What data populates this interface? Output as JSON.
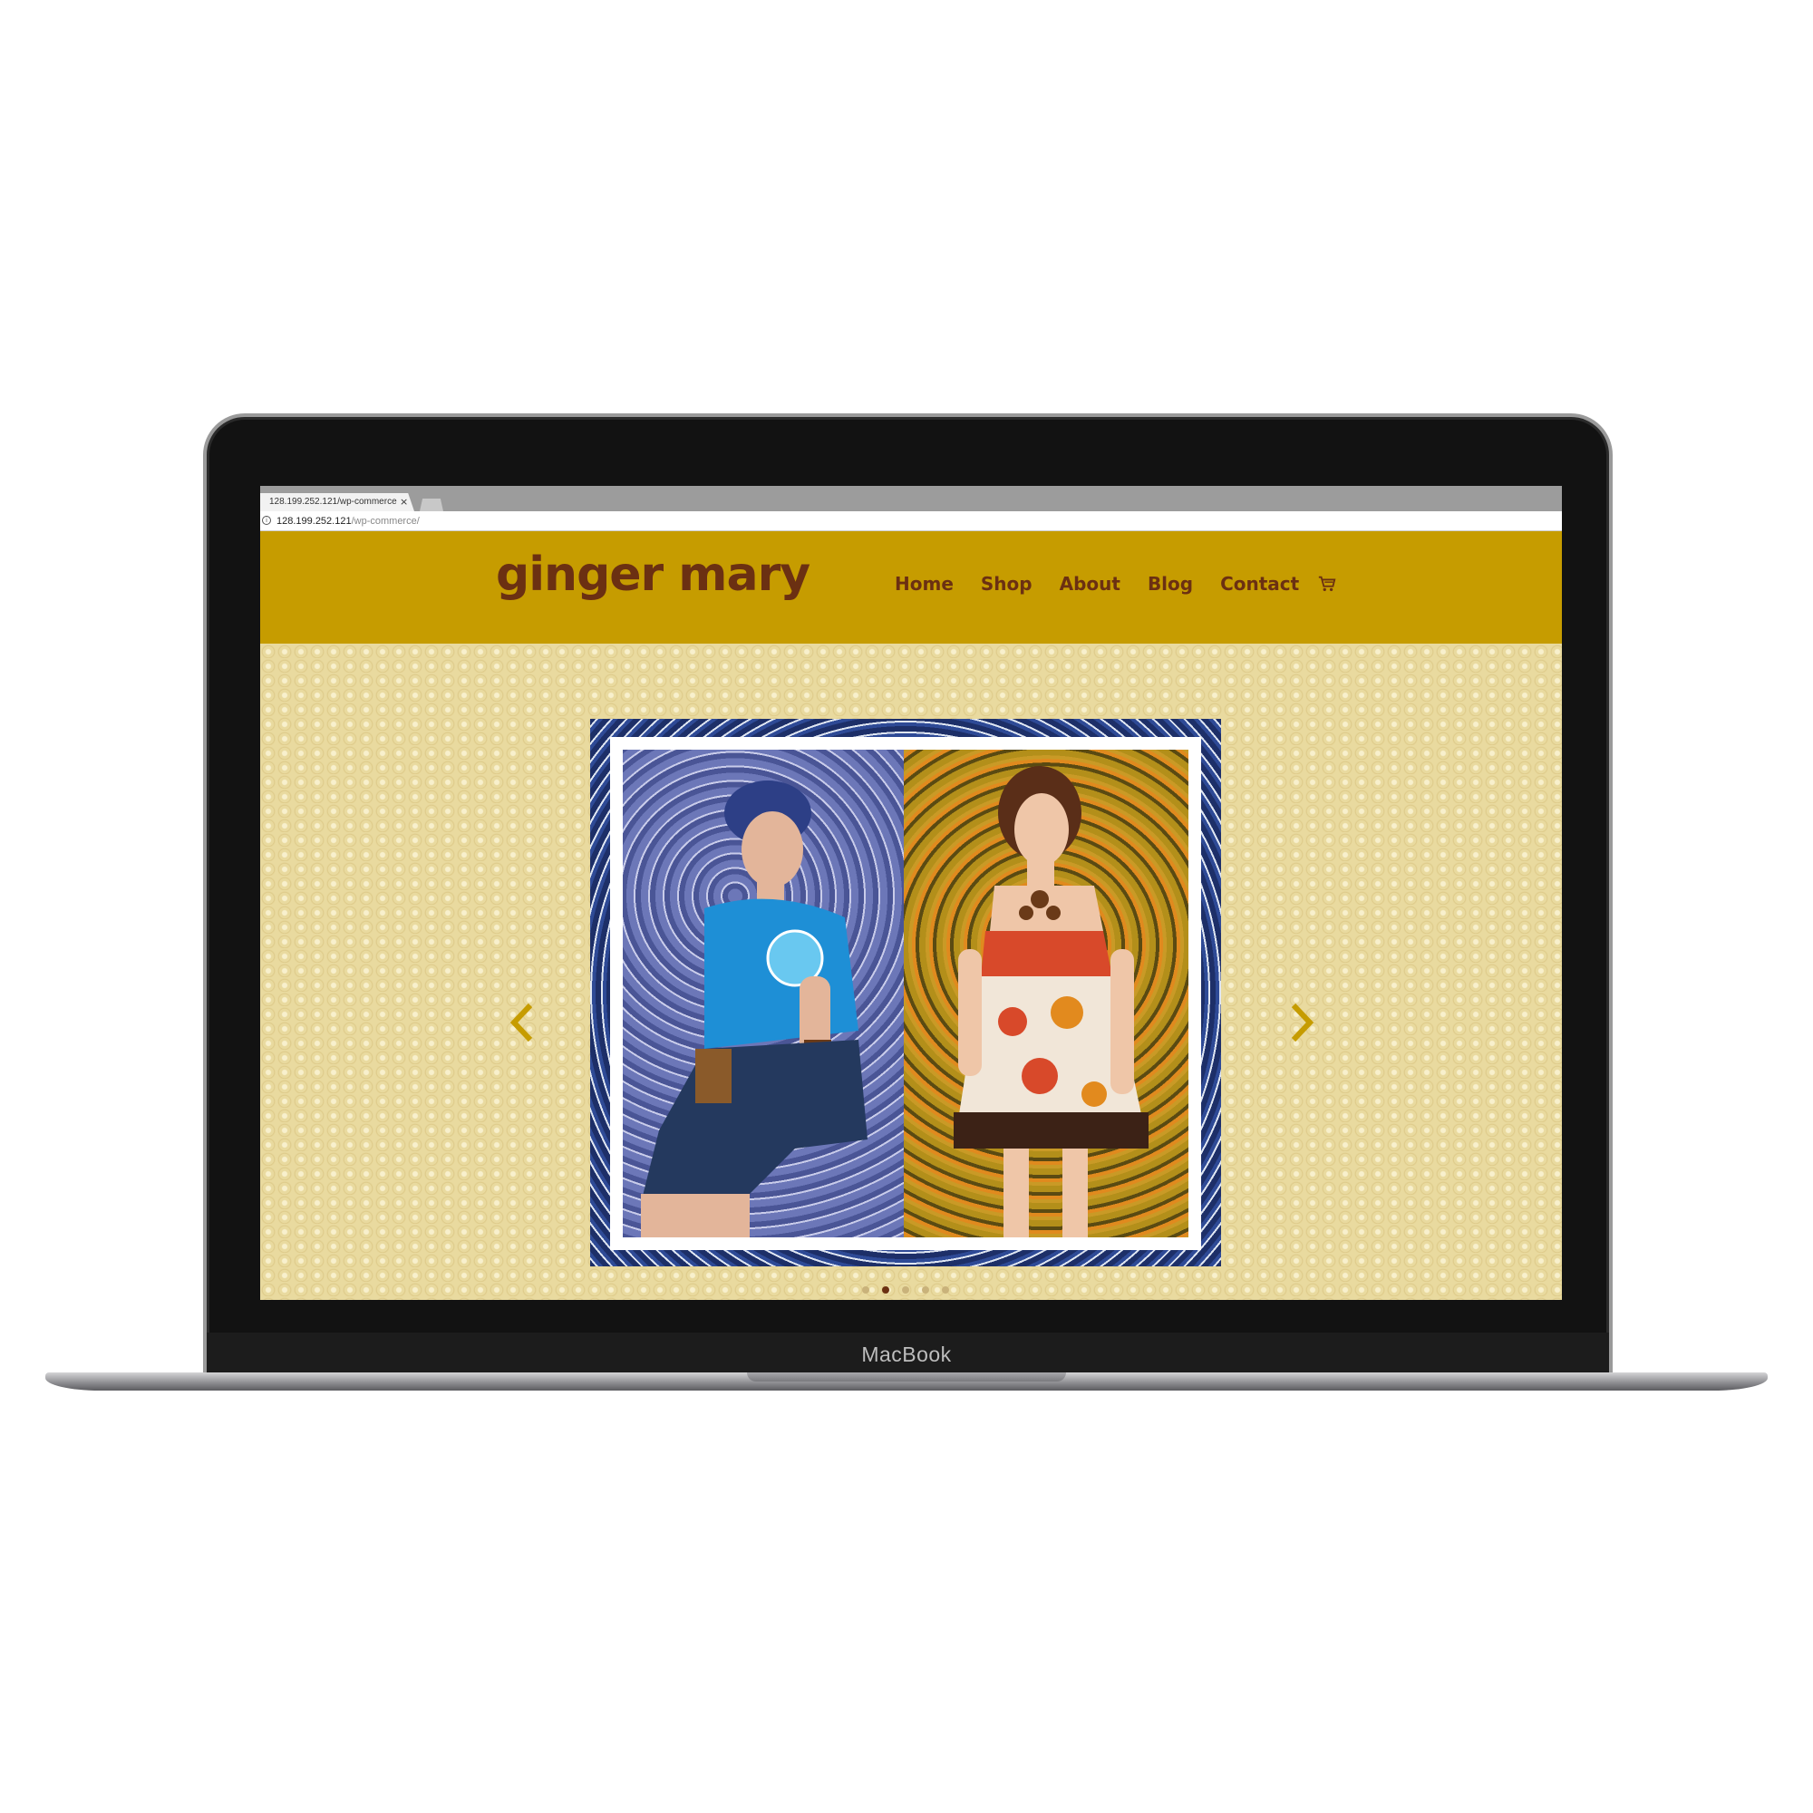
{
  "device": {
    "label": "MacBook"
  },
  "browser": {
    "tab_title": "128.199.252.121/wp-commerce",
    "tab_close": "×",
    "url_host": "128.199.252.121",
    "url_path": "/wp-commerce/"
  },
  "site": {
    "logo": "ginger mary",
    "nav": [
      {
        "label": "Home"
      },
      {
        "label": "Shop"
      },
      {
        "label": "About"
      },
      {
        "label": "Blog"
      },
      {
        "label": "Contact"
      }
    ],
    "cart_icon": "shopping-cart-icon"
  },
  "slider": {
    "slide_count": 5,
    "active_index": 1
  },
  "colors": {
    "header": "#c69c00",
    "logo_text": "#6b3012",
    "arrow": "#c69c00",
    "background": "#e9da9f"
  }
}
